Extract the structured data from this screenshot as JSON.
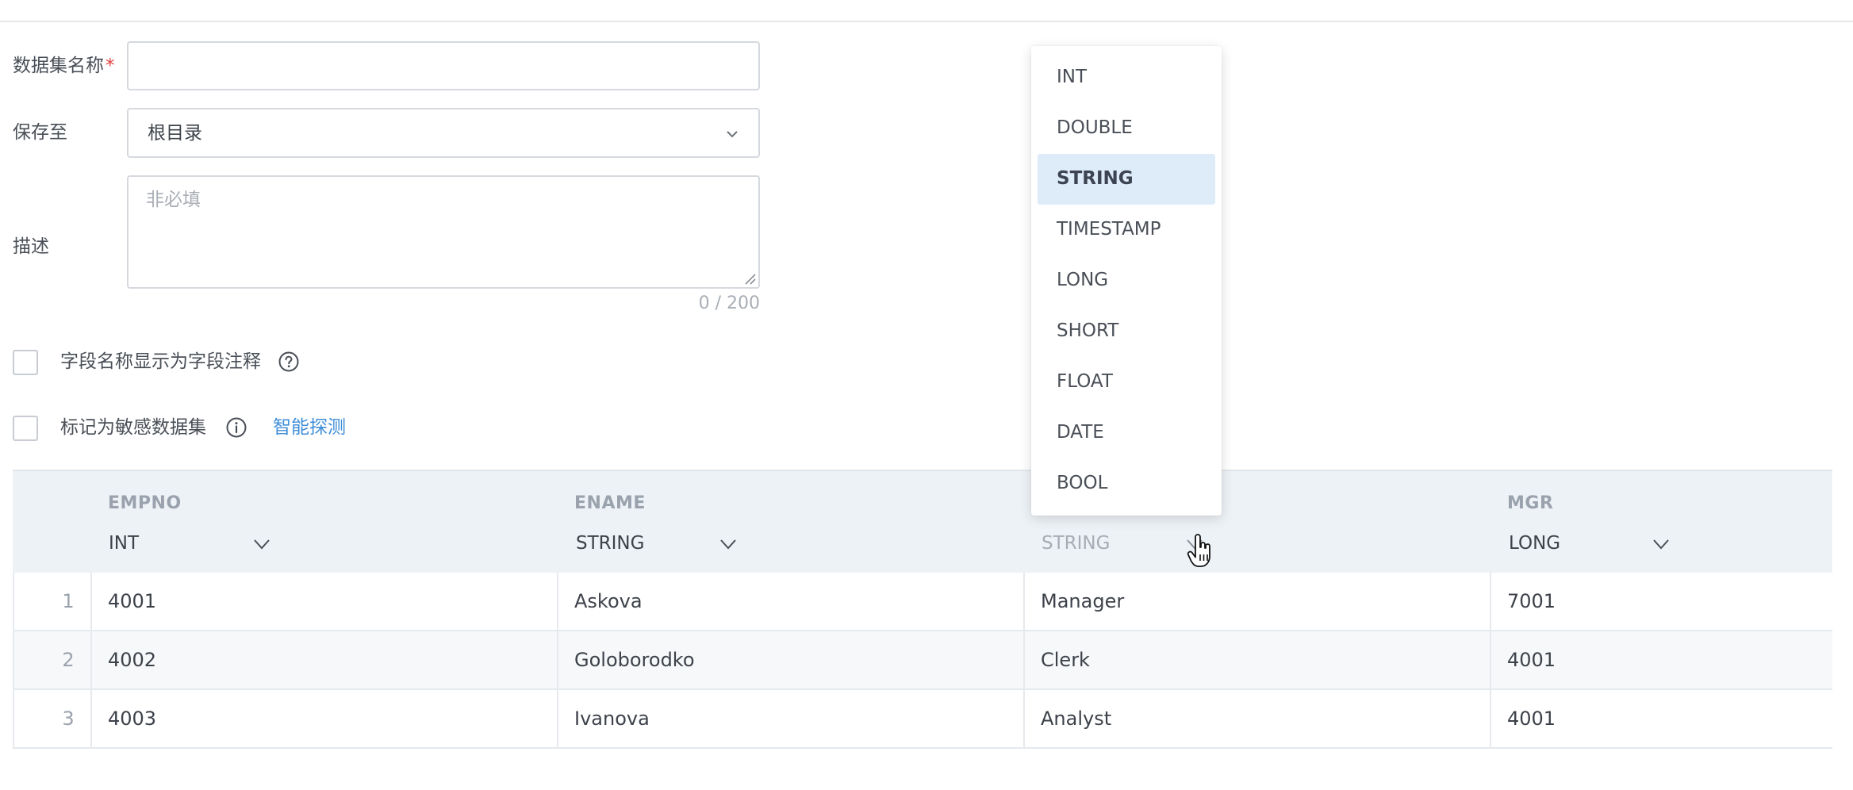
{
  "form": {
    "name_label": "数据集名称",
    "required_mark": "*",
    "name_value": "",
    "save_label": "保存至",
    "save_value": "根目录",
    "desc_label": "描述",
    "desc_placeholder": "非必填",
    "desc_counter": "0 / 200"
  },
  "options": {
    "field_comment_label": "字段名称显示为字段注释",
    "sensitive_label": "标记为敏感数据集",
    "smart_detect_link": "智能探测"
  },
  "table": {
    "columns": [
      {
        "name": "EMPNO",
        "type": "INT"
      },
      {
        "name": "ENAME",
        "type": "STRING"
      },
      {
        "name": "",
        "type": "STRING"
      },
      {
        "name": "MGR",
        "type": "LONG"
      }
    ],
    "rows": [
      {
        "num": "1",
        "cells": [
          "4001",
          "Askova",
          "Manager",
          "7001"
        ]
      },
      {
        "num": "2",
        "cells": [
          "4002",
          "Goloborodko",
          "Clerk",
          "4001"
        ]
      },
      {
        "num": "3",
        "cells": [
          "4003",
          "Ivanova",
          "Analyst",
          "4001"
        ]
      }
    ]
  },
  "type_dropdown": {
    "options": [
      "INT",
      "DOUBLE",
      "STRING",
      "TIMESTAMP",
      "LONG",
      "SHORT",
      "FLOAT",
      "DATE",
      "BOOL"
    ],
    "selected": "STRING"
  },
  "colors": {
    "accent": "#3f8ed9",
    "required": "#e0433e",
    "table_header_bg": "#edf2f6",
    "selected_option_bg": "#deebf8"
  },
  "icons": {
    "select_arrow": "chevron-down-icon",
    "help": "question-circle-icon",
    "info": "info-circle-icon",
    "cursor": "hand-pointer-icon"
  }
}
